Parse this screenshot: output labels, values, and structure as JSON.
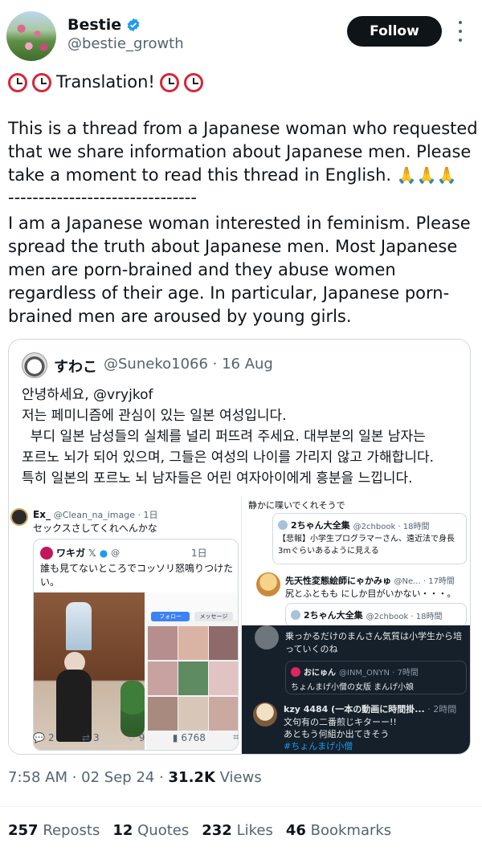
{
  "author": {
    "name": "Bestie",
    "handle": "@bestie_growth",
    "follow_label": "Follow"
  },
  "tweet": {
    "headline": "Translation!",
    "paragraph1": "This is a thread from a Japanese woman who requested that we share information about Japanese men. Please take a moment to read this thread in English.",
    "separator": "-------------------------------",
    "paragraph2": "I am a Japanese woman interested in feminism. Please spread the truth about Japanese men. Most Japanese men are porn-brained and they abuse women regardless of their age. In particular, Japanese porn-brained men are aroused by young girls."
  },
  "quote": {
    "name": "すわこ",
    "handle": "@Suneko1066 · 16 Aug",
    "lines": [
      "안녕하세요, @vryjkof",
      "저는 페미니즘에 관심이 있는 일본 여성입니다.",
      "  부디 일본 남성들의 실체를 널리 퍼뜨려 주세요. 대부분의 일본 남자는",
      "포르노 뇌가 되어 있으며, 그들은 여성의 나이를 가리지 않고 가해합니다.",
      "특히 일본의 포르노 뇌 남자들은 어린 여자아이에게 흥분을 느낍니다."
    ],
    "screenshot": {
      "ex_name": "Ex_",
      "ex_handle": "@Clean_na_image · 1日",
      "ex_text": "セックスさしてくれへんかな",
      "wakigi_name": "ワキガ",
      "wakigi_handle": "@",
      "wakigi_date": "1日",
      "wakigi_text": "誰も見てないところでコッソリ怒鳴りつけたい。",
      "profile_follow": "フォロー",
      "profile_message": "メッセージ",
      "r1_top": "静かに喋いでくれそうで",
      "r1_name": "2ちゃん大全集",
      "r1_handle": "@2chbook · 18時間",
      "r1_text": "【悲報】小学生プログラマーさん、遠近法で身長3mぐらいあるように見える",
      "r2_name": "先天性変態絵師にゃかみゅ",
      "r2_handle": "@Ne... · 17時間",
      "r2_text": "尻とふともも にしか目がいかない・・・。",
      "r2_quote_name": "2ちゃん大全集",
      "r2_quote_handle": "@2chbook · 18時間",
      "d1_text": "乗っかるだけのまんさん気質は小学生から培っていくのね",
      "d1_quote_name": "おにゅん",
      "d1_quote_handle": "@INM_ONYN · 7時間",
      "d1_quote_text": "ちょんまげ小僧の女版 まんげ小娘",
      "d2_name": "kzy 4484 (一本の動画に時間掛...",
      "d2_time": "· 2時間",
      "d2_line1": "文句有の二番煎じキターー!!",
      "d2_line2": "あともう何組か出てきそう",
      "d2_tag": "#ちょんまげ小僧",
      "replies": "2",
      "reposts": "3",
      "likes": "9",
      "views": "6768"
    }
  },
  "meta": {
    "time": "7:58 AM",
    "date": "02 Sep 24",
    "views_count": "31.2K",
    "views_label": "Views"
  },
  "stats": {
    "reposts_count": "257",
    "reposts_label": "Reposts",
    "quotes_count": "12",
    "quotes_label": "Quotes",
    "likes_count": "232",
    "likes_label": "Likes",
    "bookmarks_count": "46",
    "bookmarks_label": "Bookmarks"
  },
  "colors": {
    "follow_bg": "#0f1419",
    "verified": "#1d9bf0",
    "muted": "#536471",
    "dark_panel": "#15202b"
  }
}
